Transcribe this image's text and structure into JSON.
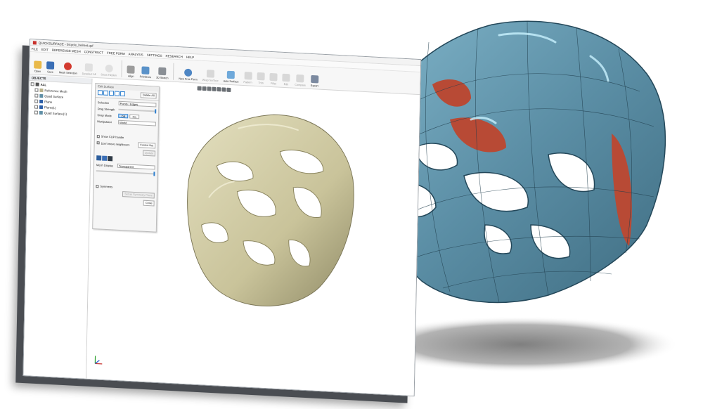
{
  "window": {
    "title": "QUICKSURFACE - bicycle_helmet.qsf"
  },
  "menu": [
    "FILE",
    "EDIT",
    "REFERENCE MESH",
    "CONSTRUCT",
    "FREE FORM",
    "ANALYSIS",
    "SETTINGS",
    "RESEARCH",
    "HELP"
  ],
  "ribbon": {
    "open": "Open",
    "save": "Save",
    "mesh_selection": "Mesh Selection",
    "deselect_all": "Deselect All",
    "show_hidden": "Show Hidden",
    "align": "Align",
    "primitives": "Primitives",
    "sketch_3d": "3D Sketch",
    "new_free_form": "New Free Form",
    "wrap_surface": "Wrap Surface",
    "auto_surface": "Auto Surface",
    "pattern": "Pattern",
    "trim": "Trim",
    "fillet": "Fillet",
    "edit": "Edit",
    "compare": "Compare",
    "export": "Export"
  },
  "objects_panel": {
    "header": "OBJECTS",
    "items": [
      {
        "label": "ALL"
      },
      {
        "label": "Reference Mesh"
      },
      {
        "label": "Quad Surface"
      },
      {
        "label": "Plane"
      },
      {
        "label": "Plane(1)"
      },
      {
        "label": "Quad Surface(1)"
      }
    ]
  },
  "edit_panel": {
    "title": "Edit Surface",
    "delete_all": "Delete All",
    "selection_label": "Selection",
    "selection_value": "Points / Edges",
    "drag_strength_label": "Drag Strength",
    "snap_mode_label": "Snap Mode",
    "snap_off": "Off",
    "snap_on": "On",
    "manipulator_label": "Manipulator",
    "manipulator_value": "World",
    "show_cup_handle": "Show CUP handle",
    "dont_move_neighbours": "Don't move neighbours",
    "control_net": "Control Net",
    "update": "Update",
    "mesh_display_label": "Mesh Display",
    "mesh_display_value": "Transparent",
    "symmetry": "Symmetry",
    "set_as_symmetry_plane": "Set as Symmetry Plane",
    "close": "Close"
  },
  "colors": {
    "helmet_gold": "#c9c39a",
    "helmet_blue": "#5f8fa6",
    "accent_red": "#c8312c",
    "accent_blue": "#2c7fcf"
  }
}
